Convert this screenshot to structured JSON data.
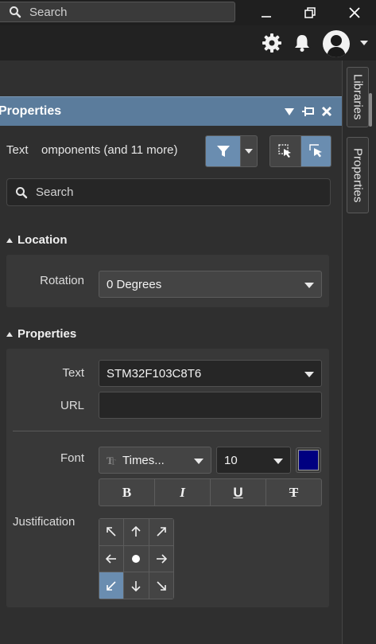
{
  "titlebar": {
    "search_placeholder": "Search"
  },
  "panel": {
    "title": "Properties",
    "filter": {
      "label": "Text",
      "description": "omponents (and 11 more)"
    },
    "search_placeholder": "Search"
  },
  "location": {
    "title": "Location",
    "rotation_label": "Rotation",
    "rotation_value": "0 Degrees"
  },
  "properties": {
    "title": "Properties",
    "text_label": "Text",
    "text_value": "STM32F103C8T6",
    "url_label": "URL",
    "url_value": "",
    "font_label": "Font",
    "font_family": "Times...",
    "font_size": "10",
    "font_color": "#000080",
    "format_buttons": [
      "B",
      "I",
      "U",
      "T"
    ],
    "justification_label": "Justification",
    "justification_selected": "bottom-left"
  },
  "side_tabs": [
    "Libraries",
    "Properties"
  ],
  "colors": {
    "accent": "#5b7c9c",
    "selected": "#6a8db0"
  }
}
